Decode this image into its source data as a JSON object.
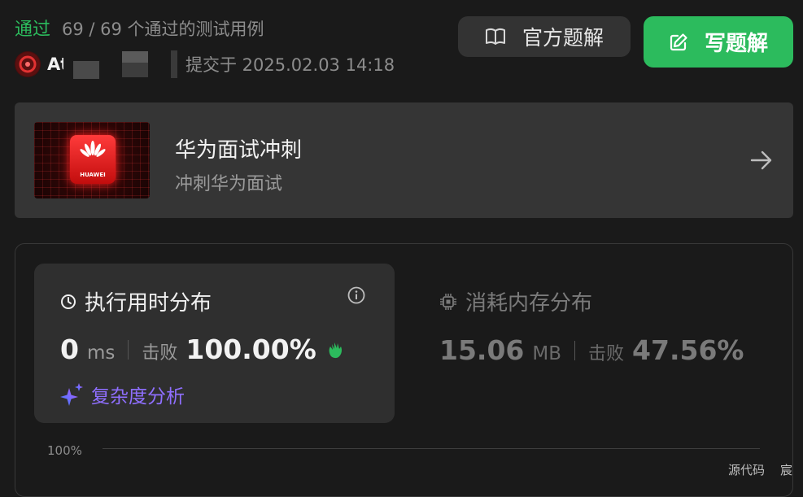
{
  "status": {
    "label": "通过",
    "count": "69 / 69 个通过的测试用例"
  },
  "user": {
    "name": "At",
    "submitted": "提交于 2025.02.03 14:18"
  },
  "buttons": {
    "official": "官方题解",
    "write": "写题解"
  },
  "banner": {
    "title": "华为面试冲刺",
    "subtitle": "冲刺华为面试",
    "logo_text": "HUAWEI"
  },
  "runtime": {
    "title": "执行用时分布",
    "value": "0",
    "unit": "ms",
    "beats_label": "击败",
    "beats_value": "100.00%",
    "complexity": "复杂度分析"
  },
  "memory": {
    "title": "消耗内存分布",
    "value": "15.06",
    "unit": "MB",
    "beats_label": "击败",
    "beats_value": "47.56%"
  },
  "chart": {
    "y_label": "100%"
  },
  "footer": {
    "source": "源代码",
    "cut": "宸"
  },
  "colors": {
    "accent_green": "#2cbb5d",
    "complexity_purple": "#8f6fff"
  }
}
